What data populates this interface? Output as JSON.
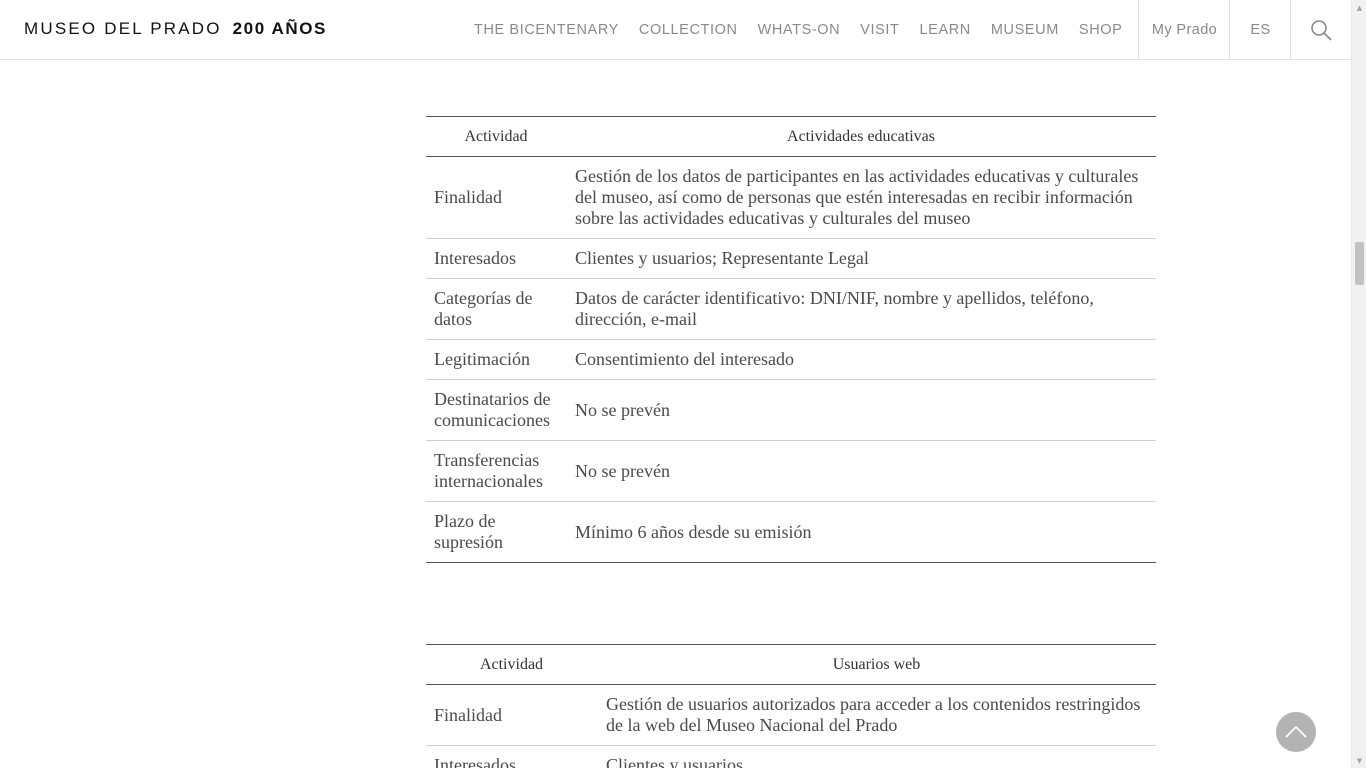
{
  "header": {
    "logo_light": "MUSEO DEL PRADO",
    "logo_bold": "200 AÑOS",
    "nav": [
      {
        "label": "THE BICENTENARY"
      },
      {
        "label": "COLLECTION"
      },
      {
        "label": "WHATS-ON"
      },
      {
        "label": "VISIT"
      },
      {
        "label": "LEARN"
      },
      {
        "label": "MUSEUM"
      },
      {
        "label": "SHOP"
      }
    ],
    "my_prado": "My Prado",
    "language": "ES",
    "search_icon": "search-icon"
  },
  "table1": {
    "col_activity": "Actividad",
    "col_value": "Actividades educativas",
    "rows": [
      {
        "label": "Finalidad",
        "value": "Gestión de los datos de participantes en las actividades educativas y culturales del museo, así como de personas que estén interesadas en recibir información sobre las actividades educativas y culturales del museo"
      },
      {
        "label": "Interesados",
        "value": "Clientes y usuarios; Representante Legal"
      },
      {
        "label": "Categorías de datos",
        "value": "Datos de carácter identificativo: DNI/NIF, nombre y apellidos, teléfono, dirección, e-mail"
      },
      {
        "label": "Legitimación",
        "value": "Consentimiento del interesado"
      },
      {
        "label": "Destinatarios de comunicaciones",
        "value": "No se prevén"
      },
      {
        "label": "Transferencias internacionales",
        "value": "No se prevén"
      },
      {
        "label": "Plazo de supresión",
        "value": "Mínimo 6 años desde su emisión"
      }
    ]
  },
  "table2": {
    "col_activity": "Actividad",
    "col_value": "Usuarios web",
    "rows": [
      {
        "label": "Finalidad",
        "value": "Gestión de usuarios autorizados para acceder a los contenidos restringidos de la web del Museo Nacional del Prado"
      },
      {
        "label": "Interesados",
        "value": "Clientes y usuarios"
      }
    ]
  },
  "back_to_top_icon": "chevron-up-icon",
  "colors": {
    "text": "#4a4a4a",
    "nav_text": "#8a8a8a",
    "divider": "#cfcfcf",
    "back_to_top_bg": "#b3b3b3"
  }
}
